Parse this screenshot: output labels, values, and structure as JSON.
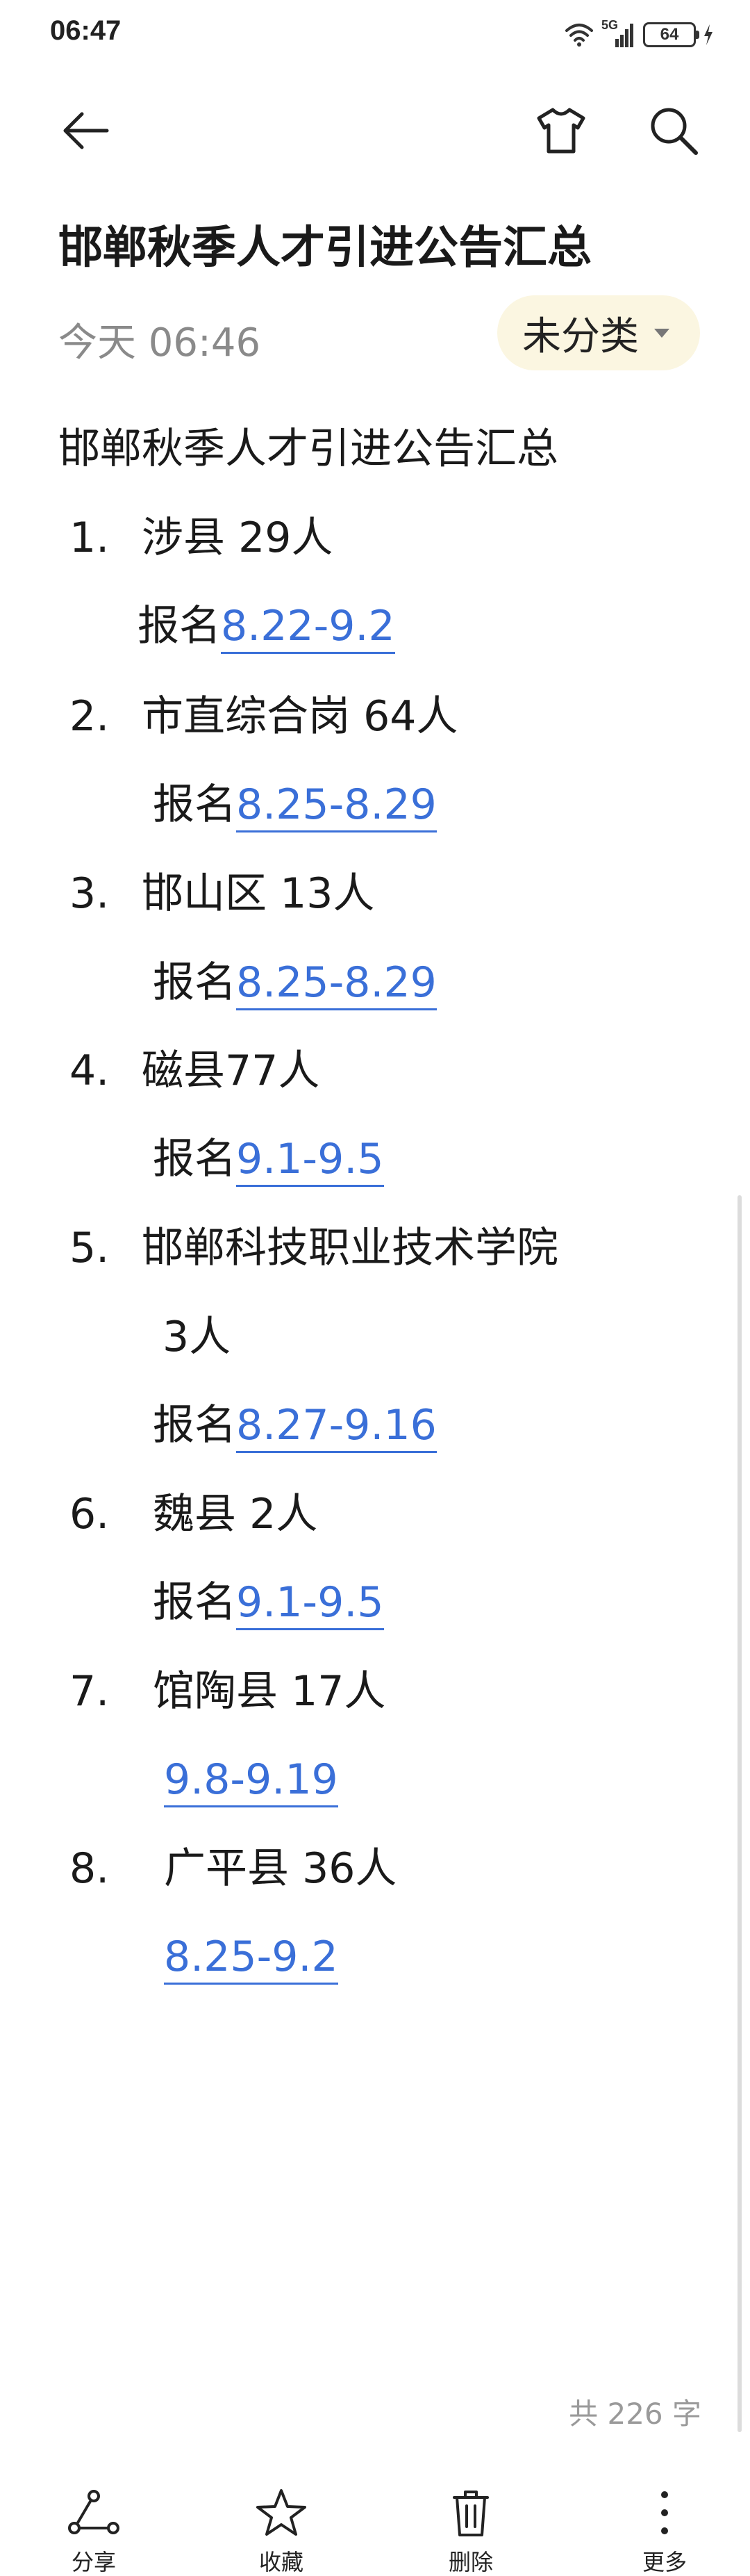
{
  "status_bar": {
    "time": "06:47",
    "network": "5G",
    "battery": "64"
  },
  "toolbar": {
    "back_icon": "arrow-left-icon",
    "theme_icon": "tshirt-icon",
    "search_icon": "search-icon"
  },
  "note": {
    "title": "邯郸秋季人才引进公告汇总",
    "date": "今天 06:46",
    "category": "未分类",
    "heading": "邯郸秋季人才引进公告汇总",
    "items": [
      {
        "num": "1.",
        "name": "涉县 29人",
        "signup": "报名",
        "dates": "8.22-9.2"
      },
      {
        "num": "2.",
        "name": "市直综合岗 64人",
        "signup": "报名",
        "dates": "8.25-8.29"
      },
      {
        "num": "3.",
        "name": "邯山区 13人",
        "signup": "报名",
        "dates": "8.25-8.29"
      },
      {
        "num": "4.",
        "name": "磁县77人",
        "signup": "报名",
        "dates": "9.1-9.5"
      },
      {
        "num": "5.",
        "name": "邯郸科技职业技术学院",
        "name_cont": "3人",
        "signup": "报名",
        "dates": "8.27-9.16"
      },
      {
        "num": "6.",
        "name": "魏县  2人",
        "signup": "报名",
        "dates": "9.1-9.5"
      },
      {
        "num": "7.",
        "name": "馆陶县  17人",
        "signup": "",
        "dates": "9.8-9.19"
      },
      {
        "num": "8.",
        "name": "广平县   36人",
        "signup": "",
        "dates": "8.25-9.2"
      }
    ],
    "word_count": "共 226 字"
  },
  "bottom_bar": {
    "share": "分享",
    "favorite": "收藏",
    "delete": "删除",
    "more": "更多"
  },
  "colors": {
    "link": "#3a6fd8",
    "chip_bg": "#fbf6e1",
    "muted": "#8a8a8a"
  }
}
